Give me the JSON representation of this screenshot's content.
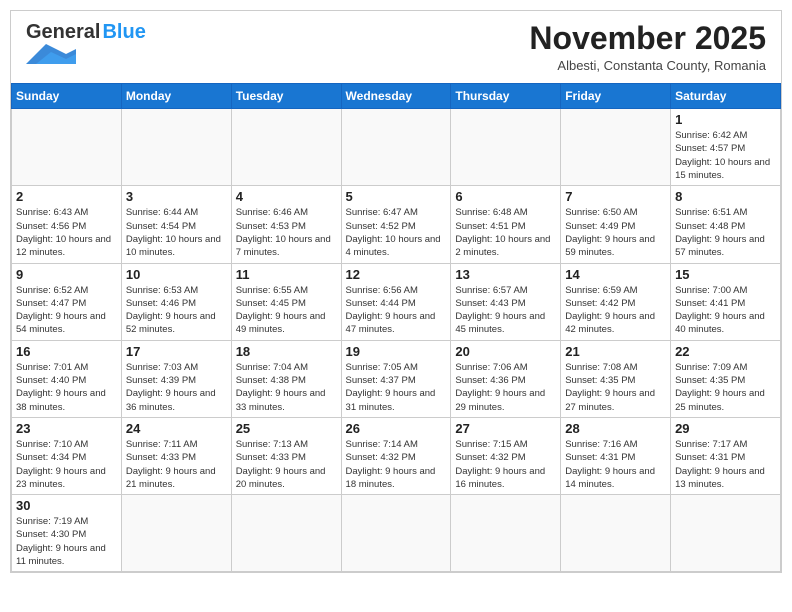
{
  "header": {
    "logo_general": "General",
    "logo_blue": "Blue",
    "month_title": "November 2025",
    "subtitle": "Albesti, Constanta County, Romania"
  },
  "days_of_week": [
    "Sunday",
    "Monday",
    "Tuesday",
    "Wednesday",
    "Thursday",
    "Friday",
    "Saturday"
  ],
  "weeks": [
    [
      {
        "day": "",
        "info": ""
      },
      {
        "day": "",
        "info": ""
      },
      {
        "day": "",
        "info": ""
      },
      {
        "day": "",
        "info": ""
      },
      {
        "day": "",
        "info": ""
      },
      {
        "day": "",
        "info": ""
      },
      {
        "day": "1",
        "info": "Sunrise: 6:42 AM\nSunset: 4:57 PM\nDaylight: 10 hours\nand 15 minutes."
      }
    ],
    [
      {
        "day": "2",
        "info": "Sunrise: 6:43 AM\nSunset: 4:56 PM\nDaylight: 10 hours\nand 12 minutes."
      },
      {
        "day": "3",
        "info": "Sunrise: 6:44 AM\nSunset: 4:54 PM\nDaylight: 10 hours\nand 10 minutes."
      },
      {
        "day": "4",
        "info": "Sunrise: 6:46 AM\nSunset: 4:53 PM\nDaylight: 10 hours\nand 7 minutes."
      },
      {
        "day": "5",
        "info": "Sunrise: 6:47 AM\nSunset: 4:52 PM\nDaylight: 10 hours\nand 4 minutes."
      },
      {
        "day": "6",
        "info": "Sunrise: 6:48 AM\nSunset: 4:51 PM\nDaylight: 10 hours\nand 2 minutes."
      },
      {
        "day": "7",
        "info": "Sunrise: 6:50 AM\nSunset: 4:49 PM\nDaylight: 9 hours\nand 59 minutes."
      },
      {
        "day": "8",
        "info": "Sunrise: 6:51 AM\nSunset: 4:48 PM\nDaylight: 9 hours\nand 57 minutes."
      }
    ],
    [
      {
        "day": "9",
        "info": "Sunrise: 6:52 AM\nSunset: 4:47 PM\nDaylight: 9 hours\nand 54 minutes."
      },
      {
        "day": "10",
        "info": "Sunrise: 6:53 AM\nSunset: 4:46 PM\nDaylight: 9 hours\nand 52 minutes."
      },
      {
        "day": "11",
        "info": "Sunrise: 6:55 AM\nSunset: 4:45 PM\nDaylight: 9 hours\nand 49 minutes."
      },
      {
        "day": "12",
        "info": "Sunrise: 6:56 AM\nSunset: 4:44 PM\nDaylight: 9 hours\nand 47 minutes."
      },
      {
        "day": "13",
        "info": "Sunrise: 6:57 AM\nSunset: 4:43 PM\nDaylight: 9 hours\nand 45 minutes."
      },
      {
        "day": "14",
        "info": "Sunrise: 6:59 AM\nSunset: 4:42 PM\nDaylight: 9 hours\nand 42 minutes."
      },
      {
        "day": "15",
        "info": "Sunrise: 7:00 AM\nSunset: 4:41 PM\nDaylight: 9 hours\nand 40 minutes."
      }
    ],
    [
      {
        "day": "16",
        "info": "Sunrise: 7:01 AM\nSunset: 4:40 PM\nDaylight: 9 hours\nand 38 minutes."
      },
      {
        "day": "17",
        "info": "Sunrise: 7:03 AM\nSunset: 4:39 PM\nDaylight: 9 hours\nand 36 minutes."
      },
      {
        "day": "18",
        "info": "Sunrise: 7:04 AM\nSunset: 4:38 PM\nDaylight: 9 hours\nand 33 minutes."
      },
      {
        "day": "19",
        "info": "Sunrise: 7:05 AM\nSunset: 4:37 PM\nDaylight: 9 hours\nand 31 minutes."
      },
      {
        "day": "20",
        "info": "Sunrise: 7:06 AM\nSunset: 4:36 PM\nDaylight: 9 hours\nand 29 minutes."
      },
      {
        "day": "21",
        "info": "Sunrise: 7:08 AM\nSunset: 4:35 PM\nDaylight: 9 hours\nand 27 minutes."
      },
      {
        "day": "22",
        "info": "Sunrise: 7:09 AM\nSunset: 4:35 PM\nDaylight: 9 hours\nand 25 minutes."
      }
    ],
    [
      {
        "day": "23",
        "info": "Sunrise: 7:10 AM\nSunset: 4:34 PM\nDaylight: 9 hours\nand 23 minutes."
      },
      {
        "day": "24",
        "info": "Sunrise: 7:11 AM\nSunset: 4:33 PM\nDaylight: 9 hours\nand 21 minutes."
      },
      {
        "day": "25",
        "info": "Sunrise: 7:13 AM\nSunset: 4:33 PM\nDaylight: 9 hours\nand 20 minutes."
      },
      {
        "day": "26",
        "info": "Sunrise: 7:14 AM\nSunset: 4:32 PM\nDaylight: 9 hours\nand 18 minutes."
      },
      {
        "day": "27",
        "info": "Sunrise: 7:15 AM\nSunset: 4:32 PM\nDaylight: 9 hours\nand 16 minutes."
      },
      {
        "day": "28",
        "info": "Sunrise: 7:16 AM\nSunset: 4:31 PM\nDaylight: 9 hours\nand 14 minutes."
      },
      {
        "day": "29",
        "info": "Sunrise: 7:17 AM\nSunset: 4:31 PM\nDaylight: 9 hours\nand 13 minutes."
      }
    ],
    [
      {
        "day": "30",
        "info": "Sunrise: 7:19 AM\nSunset: 4:30 PM\nDaylight: 9 hours\nand 11 minutes."
      },
      {
        "day": "",
        "info": ""
      },
      {
        "day": "",
        "info": ""
      },
      {
        "day": "",
        "info": ""
      },
      {
        "day": "",
        "info": ""
      },
      {
        "day": "",
        "info": ""
      },
      {
        "day": "",
        "info": ""
      }
    ]
  ]
}
